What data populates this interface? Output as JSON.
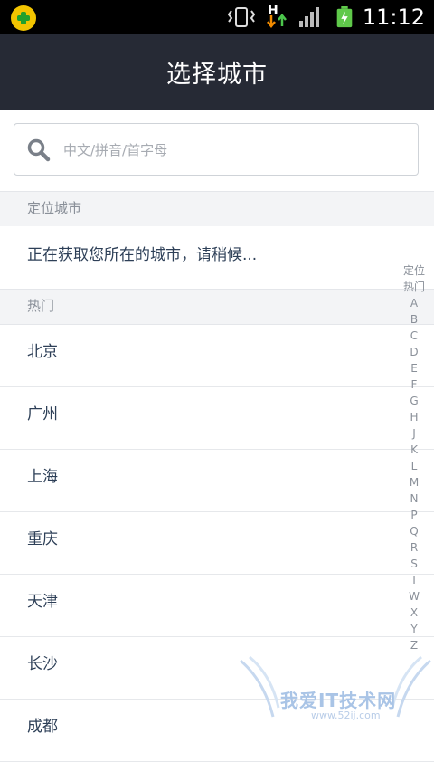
{
  "status_bar": {
    "network_letter": "H",
    "time": "11:12"
  },
  "header": {
    "title": "选择城市"
  },
  "search": {
    "placeholder": "中文/拼音/首字母"
  },
  "sections": {
    "locate_title": "定位城市",
    "locate_status": "正在获取您所在的城市，请稍候...",
    "hot_title": "热门"
  },
  "hot_cities": [
    "北京",
    "广州",
    "上海",
    "重庆",
    "天津",
    "长沙",
    "成都"
  ],
  "index_bar": [
    "定位",
    "热门",
    "A",
    "B",
    "C",
    "D",
    "E",
    "F",
    "G",
    "H",
    "J",
    "K",
    "L",
    "M",
    "N",
    "P",
    "Q",
    "R",
    "S",
    "T",
    "W",
    "X",
    "Y",
    "Z"
  ],
  "watermark": {
    "text": "我爱IT技术网",
    "url": "www.52ij.com"
  }
}
